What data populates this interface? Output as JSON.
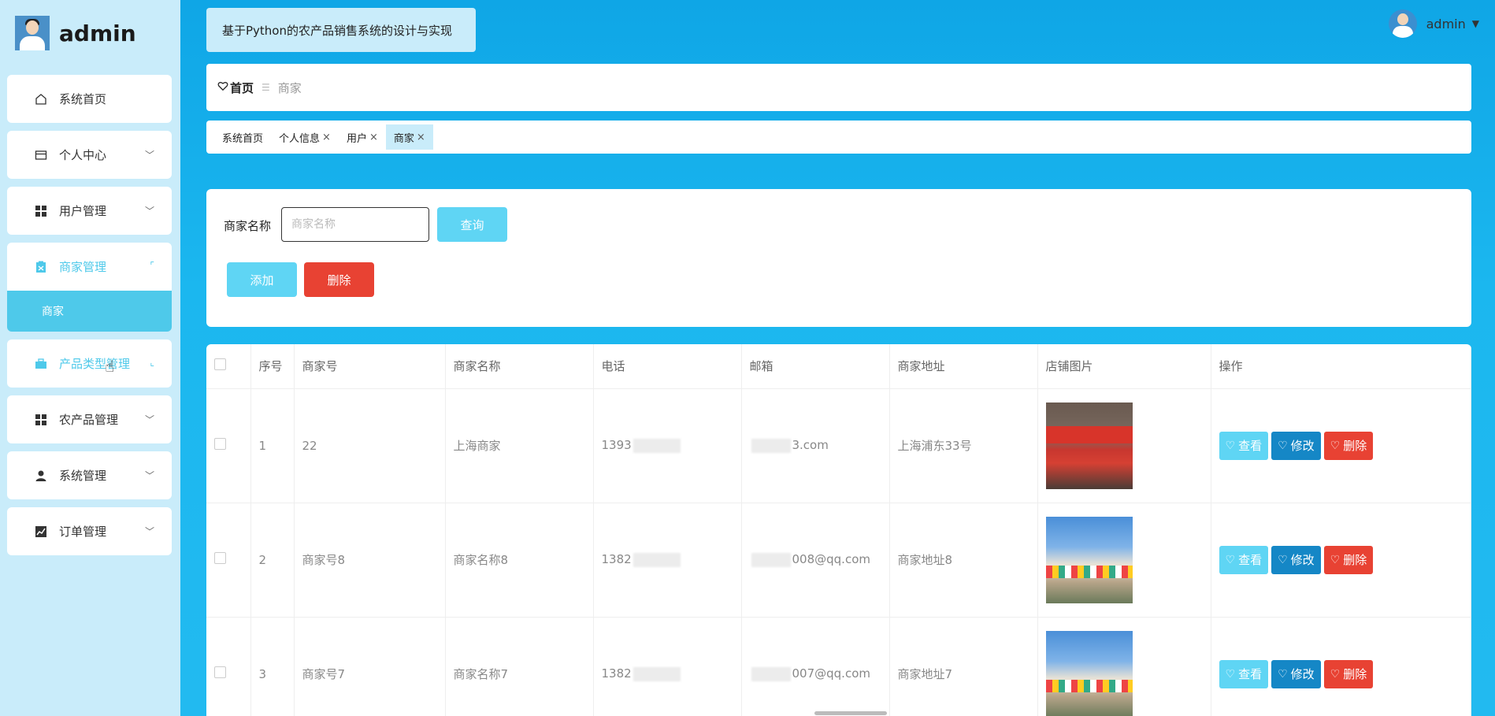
{
  "brand": {
    "name": "admin"
  },
  "sidebar": {
    "items": [
      {
        "label": "系统首页",
        "icon": "home-icon"
      },
      {
        "label": "个人中心",
        "icon": "card-icon"
      },
      {
        "label": "用户管理",
        "icon": "grid-icon"
      },
      {
        "label": "商家管理",
        "icon": "clipboard-icon"
      },
      {
        "label": "产品类型管理",
        "icon": "briefcase-icon"
      },
      {
        "label": "农产品管理",
        "icon": "grid-icon"
      },
      {
        "label": "系统管理",
        "icon": "user-icon"
      },
      {
        "label": "订单管理",
        "icon": "chart-icon"
      }
    ],
    "submenu": {
      "label": "商家"
    }
  },
  "header": {
    "title": "基于Python的农产品销售系统的设计与实现",
    "user": "admin"
  },
  "breadcrumb": {
    "home": "首页",
    "current": "商家"
  },
  "tags": [
    {
      "label": "系统首页"
    },
    {
      "label": "个人信息"
    },
    {
      "label": "用户"
    },
    {
      "label": "商家"
    }
  ],
  "search": {
    "label": "商家名称",
    "placeholder": "商家名称",
    "query_label": "查询",
    "add_label": "添加",
    "delete_label": "删除"
  },
  "table": {
    "headers": [
      "序号",
      "商家号",
      "商家名称",
      "电话",
      "邮箱",
      "商家地址",
      "店铺图片",
      "操作"
    ],
    "rows": [
      {
        "index": "1",
        "code": "22",
        "name": "上海商家",
        "phone": "1393",
        "email": "3.com",
        "address": "上海浦东33号"
      },
      {
        "index": "2",
        "code": "商家号8",
        "name": "商家名称8",
        "phone": "1382",
        "email": "008@qq.com",
        "address": "商家地址8"
      },
      {
        "index": "3",
        "code": "商家号7",
        "name": "商家名称7",
        "phone": "1382",
        "email": "007@qq.com",
        "address": "商家地址7"
      }
    ],
    "actions": {
      "view": "查看",
      "edit": "修改",
      "delete": "删除"
    }
  },
  "colors": {
    "accent": "#4ec9ea",
    "sidebar_bg": "#c9ecfa",
    "danger": "#e84233",
    "edit": "#1587c6"
  }
}
